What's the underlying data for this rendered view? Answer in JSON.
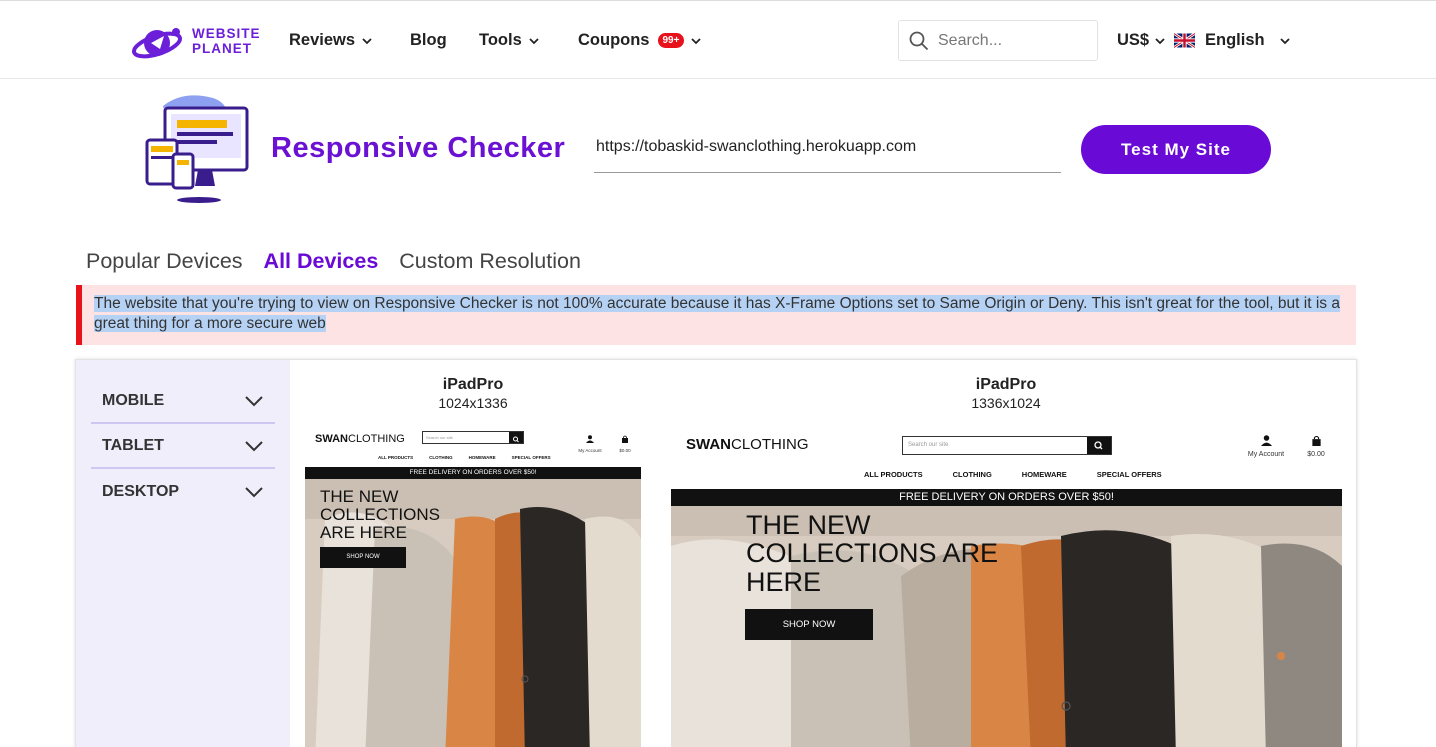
{
  "nav": {
    "logo_line1": "WEBSITE",
    "logo_line2": "PLANET",
    "reviews": "Reviews",
    "blog": "Blog",
    "tools": "Tools",
    "coupons": "Coupons",
    "coupons_badge": "99+",
    "search_placeholder": "Search...",
    "currency": "US$",
    "language": "English"
  },
  "hero": {
    "title": "Responsive Checker",
    "url_value": "https://tobaskid-swanclothing.herokuapp.com",
    "button": "Test My Site"
  },
  "tabs": [
    "Popular Devices",
    "All Devices",
    "Custom Resolution"
  ],
  "active_tab": "All Devices",
  "warning": "The website that you're trying to view on Responsive Checker is not 100% accurate because it has X-Frame Options set to Same Origin or Deny. This isn't great for the tool, but it is a great thing for a more secure web",
  "sidebar": {
    "items": [
      {
        "label": "MOBILE"
      },
      {
        "label": "TABLET"
      },
      {
        "label": "DESKTOP"
      }
    ]
  },
  "devices": [
    {
      "name": "iPadPro",
      "resolution": "1024x1336"
    },
    {
      "name": "iPadPro",
      "resolution": "1336x1024"
    }
  ],
  "preview_site": {
    "brand_bold": "SWAN",
    "brand_light": "CLOTHING",
    "search_placeholder": "Search our site",
    "account": "My Account",
    "cart_total": "$0.00",
    "nav": [
      "ALL PRODUCTS",
      "CLOTHING",
      "HOMEWARE",
      "SPECIAL OFFERS"
    ],
    "promo": "FREE DELIVERY ON ORDERS OVER $50!",
    "hero_text_portrait": [
      "THE NEW",
      "COLLECTIONS",
      "ARE HERE"
    ],
    "hero_text_landscape": [
      "THE NEW",
      "COLLECTIONS ARE",
      "HERE"
    ],
    "shop_now": "SHOP NOW"
  },
  "colors": {
    "brand_purple": "#6a0ad6",
    "warning_bg": "#fde3e4",
    "warning_border": "#e8121b",
    "sidebar_bg": "#f1eefc"
  }
}
